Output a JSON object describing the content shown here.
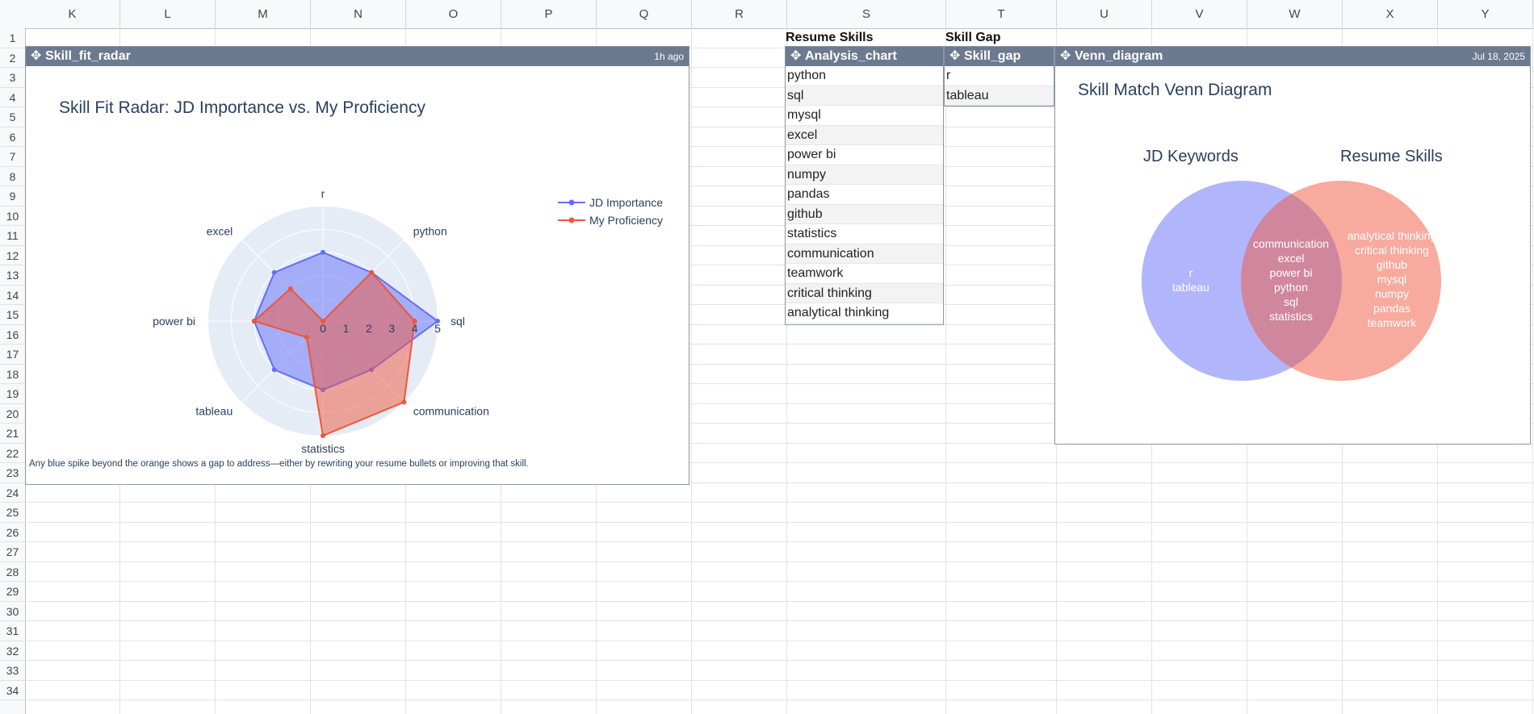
{
  "columns": [
    "K",
    "L",
    "M",
    "N",
    "O",
    "P",
    "Q",
    "R",
    "S",
    "T",
    "U",
    "V",
    "W",
    "X",
    "Y"
  ],
  "rows": [
    "1",
    "2",
    "3",
    "4",
    "5",
    "6",
    "7",
    "8",
    "9",
    "10",
    "11",
    "12",
    "13",
    "14",
    "15",
    "16",
    "17",
    "18",
    "19",
    "20",
    "21",
    "22",
    "23",
    "24",
    "25",
    "26",
    "27",
    "28",
    "29",
    "30",
    "31",
    "32",
    "33",
    "34"
  ],
  "cells": {
    "resume_skills_header": "Resume Skills",
    "skill_gap_header": "Skill Gap"
  },
  "panels": {
    "radar": {
      "title": "Skill_fit_radar",
      "meta": "1h ago",
      "note": "Any blue spike beyond the orange shows a gap to address—either by rewriting your resume bullets or improving that skill."
    },
    "analysis": {
      "title": "Analysis_chart",
      "items": [
        "python",
        "sql",
        "mysql",
        "excel",
        "power bi",
        "numpy",
        "pandas",
        "github",
        "statistics",
        "communication",
        "teamwork",
        "critical thinking",
        "analytical thinking"
      ]
    },
    "gap": {
      "title": "Skill_gap",
      "items": [
        "r",
        "tableau"
      ]
    },
    "venn": {
      "title": "Venn_diagram",
      "meta": "Jul 18, 2025"
    }
  },
  "icons": {
    "panel_icon": "move-icon"
  },
  "colors": {
    "panel_header": "#6b7a8f",
    "jd": "#636efa",
    "mine": "#ef553b",
    "polar_bg": "#e5ecf6"
  },
  "chart_data": [
    {
      "type": "radar",
      "title": "Skill Fit Radar: JD Importance vs. My Proficiency",
      "categories": [
        "r",
        "python",
        "sql",
        "communication",
        "statistics",
        "tableau",
        "power bi",
        "excel"
      ],
      "radial_range": [
        0,
        5
      ],
      "radial_ticks": [
        0,
        1,
        2,
        3,
        4,
        5
      ],
      "legend_position": "top-right",
      "series": [
        {
          "name": "JD Importance",
          "values": [
            3,
            3,
            5,
            3,
            3,
            3,
            3,
            3
          ],
          "color": "#636efa"
        },
        {
          "name": "My Proficiency",
          "values": [
            0,
            3,
            4,
            5,
            5,
            1,
            3,
            2
          ],
          "color": "#ef553b"
        }
      ]
    },
    {
      "type": "venn",
      "title": "Skill Match Venn Diagram",
      "sets": [
        {
          "name": "JD Keywords",
          "only": [
            "r",
            "tableau"
          ],
          "color": "#636efa"
        },
        {
          "name": "Resume Skills",
          "only": [
            "analytical thinking",
            "critical thinking",
            "github",
            "mysql",
            "numpy",
            "pandas",
            "teamwork"
          ],
          "color": "#ef553b"
        }
      ],
      "intersection": [
        "communication",
        "excel",
        "power bi",
        "python",
        "sql",
        "statistics"
      ]
    }
  ]
}
